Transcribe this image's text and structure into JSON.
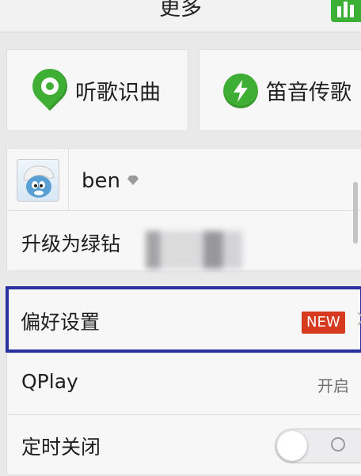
{
  "header": {
    "title": "更多",
    "eq_icon": "equalizer-bars-icon"
  },
  "feature_cards": [
    {
      "label": "听歌识曲",
      "icon": "location-pin-icon",
      "color": "#3fae34"
    },
    {
      "label": "笛音传歌",
      "icon": "lightning-bolt-icon",
      "color": "#3fae34"
    }
  ],
  "account": {
    "username": "ben",
    "badge_icon": "diamond-icon",
    "upgrade_label": "升级为绿钻"
  },
  "settings": {
    "preferences_label": "偏好设置",
    "preferences_badge": "NEW",
    "qplay_label": "QPlay",
    "qplay_status": "开启",
    "timer_label": "定时关闭",
    "timer_enabled": false
  },
  "colors": {
    "accent_green": "#3fae34",
    "new_badge": "#d63b1f",
    "highlight_frame": "#2930a0",
    "background": "#e9e9ea"
  }
}
